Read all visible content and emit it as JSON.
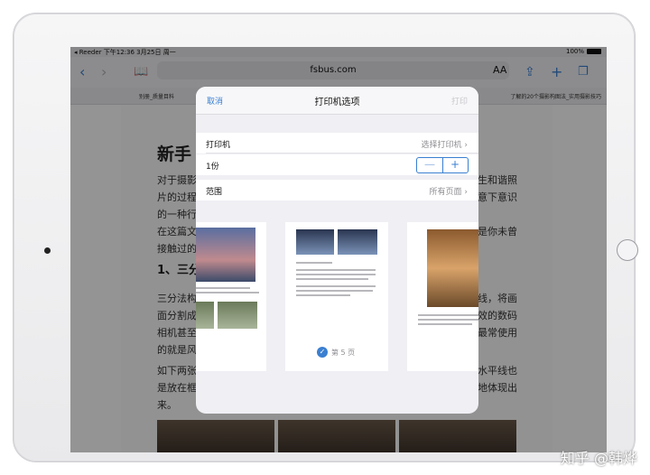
{
  "status_bar": {
    "left": "◂ Reeder  下午12:36  3月25日 周一",
    "right": "100%"
  },
  "browser": {
    "url": "fsbus.com",
    "aa": "AA"
  },
  "tabs": {
    "left": "别册_质量目料",
    "right": "了解的20个摄影构图法_实用摄影技巧"
  },
  "article": {
    "title": "新手",
    "p1_lines": [
      "对于摄影",
      "片的过程",
      "的一种行",
      "在这篇文",
      "接触过的"
    ],
    "p1_right": [
      "生和谐照",
      "意下意识",
      "",
      "是你未曾",
      ""
    ],
    "section": "1、三分",
    "p2_lines": [
      "三分法构",
      "面分割成",
      "相机甚至",
      "的就是风"
    ],
    "p2_right": [
      "线，将画",
      "效的数码",
      "最常使用",
      ""
    ],
    "p3_lines": [
      "如下两张",
      "是放在框",
      "来。"
    ],
    "p3_right": [
      "水平线也",
      "地体现出",
      ""
    ]
  },
  "print_dialog": {
    "cancel": "取消",
    "title": "打印机选项",
    "print": "打印",
    "printer_label": "打印机",
    "printer_value": "选择打印机",
    "copies_label": "1份",
    "range_label": "范围",
    "range_value": "所有页面",
    "minus": "—",
    "plus": "+",
    "selected_page": "第 5 页"
  },
  "watermark": "知乎 @韩烨",
  "colors": {
    "accent": "#3a7fd1"
  }
}
